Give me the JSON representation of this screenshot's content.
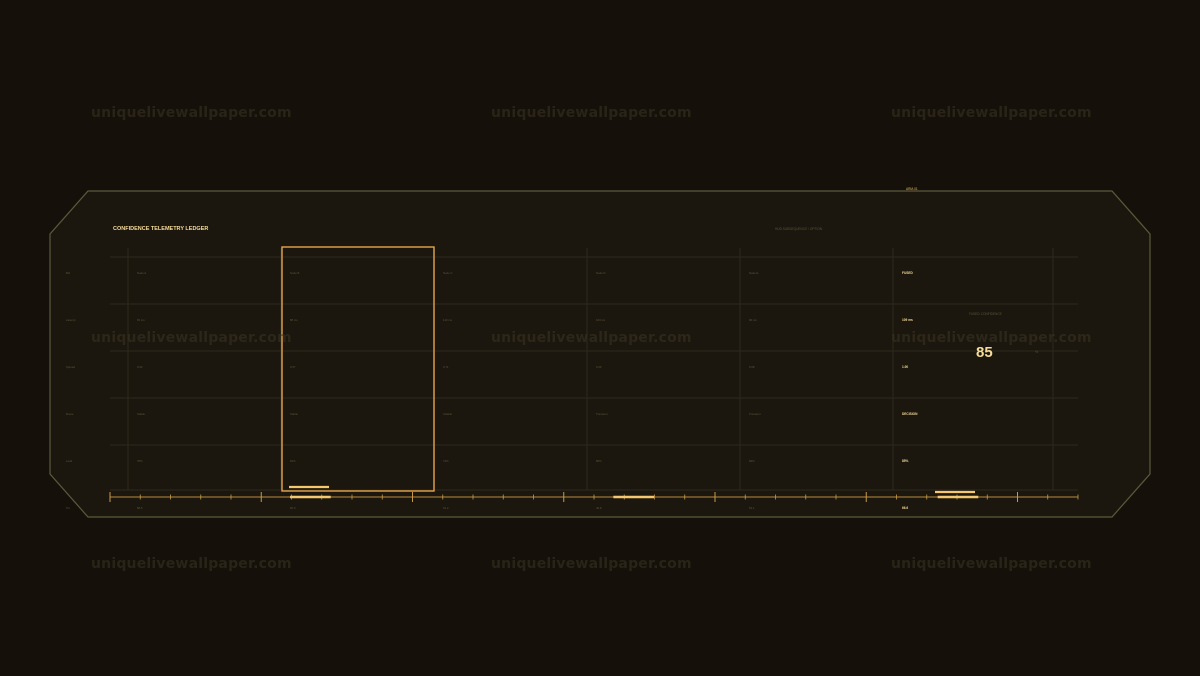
{
  "panel": {
    "title": "CONFIDENCE TELEMETRY LEDGER",
    "subtitle": "HUD SUBSEQUENCE / OPTION",
    "badge": "ARM-01"
  },
  "ledger": {
    "row_labels": [
      "Bid",
      "Latency",
      "Spread",
      "Route",
      "Load",
      "Tot"
    ],
    "columns": [
      {
        "cells": [
          "Node A",
          "93 ms",
          "0.62",
          "Stable",
          "78%",
          "58.5"
        ]
      },
      {
        "cells": [
          "Node B",
          "88 ms",
          "0.57",
          "Stable",
          "81%",
          "60.0"
        ]
      },
      {
        "cells": [
          "Node C",
          "110 ms",
          "0.71",
          "Volatile",
          "74%",
          "51.2"
        ]
      },
      {
        "cells": [
          "Node D",
          "103 ms",
          "0.66",
          "Transient",
          "86%",
          "49.8"
        ]
      },
      {
        "cells": [
          "Node E",
          "96 ms",
          "0.68",
          "Transient",
          "69%",
          "54.1"
        ]
      },
      {
        "cells": [
          "FUSED",
          "109 ms",
          "1.00",
          "DECISION",
          "85%",
          "66.6"
        ]
      }
    ],
    "selected_column": 1
  },
  "fused": {
    "label": "FUSED CONFIDENCE",
    "value": "85",
    "unit": "%"
  },
  "timeline": {
    "markers": [
      {
        "label": "marker-1",
        "start": 0.186,
        "end": 0.228
      },
      {
        "label": "marker-2",
        "start": 0.52,
        "end": 0.562
      },
      {
        "label": "marker-3",
        "start": 0.855,
        "end": 0.897
      }
    ]
  },
  "watermarks": [
    "uniquelivewallpaper.com",
    "uniquelivewallpaper.com",
    "uniquelivewallpaper.com",
    "uniquelivewallpaper.com",
    "uniquelivewallpaper.com",
    "uniquelivewallpaper.com",
    "uniquelivewallpaper.com",
    "uniquelivewallpaper.com",
    "uniquelivewallpaper.com"
  ],
  "colors": {
    "background": "#15110a",
    "frame": "#5c5a3c",
    "accent": "#e7a64a",
    "accent_bright": "#f4c770"
  }
}
